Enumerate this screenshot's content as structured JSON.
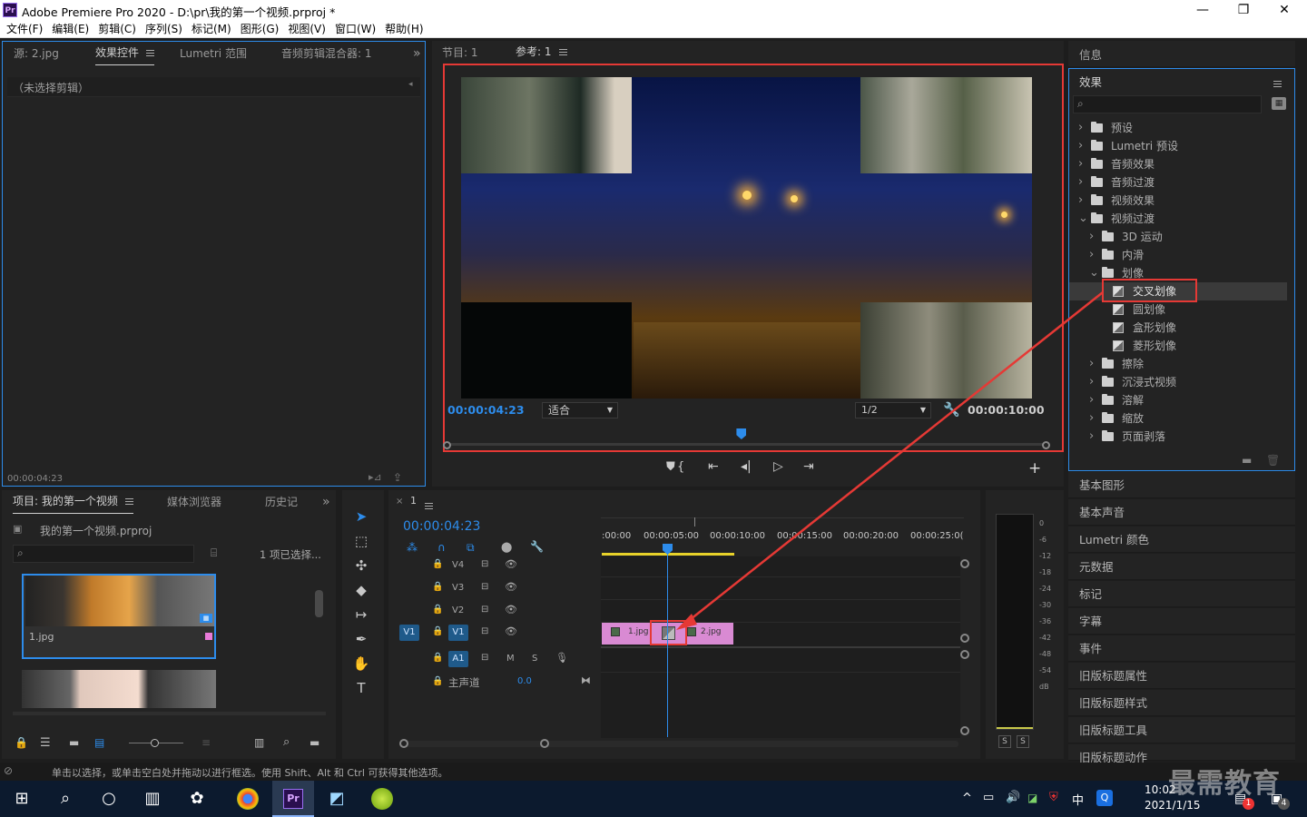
{
  "window": {
    "title": "Adobe Premiere Pro 2020 - D:\\pr\\我的第一个视频.prproj *",
    "app_icon": "Pr",
    "controls": [
      "—",
      "❐",
      "✕"
    ]
  },
  "menu": [
    "文件(F)",
    "编辑(E)",
    "剪辑(C)",
    "序列(S)",
    "标记(M)",
    "图形(G)",
    "视图(V)",
    "窗口(W)",
    "帮助(H)"
  ],
  "source_panel": {
    "tabs": [
      "源: 2.jpg",
      "效果控件",
      "Lumetri 范围",
      "音频剪辑混合器: 1"
    ],
    "active_tab": "效果控件",
    "empty_msg": "（未选择剪辑）",
    "timecode": "00:00:04:23",
    "overflow": "»"
  },
  "program_panel": {
    "tabs": [
      "节目: 1",
      "参考: 1"
    ],
    "timecode": "00:00:04:23",
    "fit": "适合",
    "quality": "1/2",
    "duration": "00:00:10:00",
    "playhead_fraction": 0.49,
    "add_btn": "+"
  },
  "effects_panel": {
    "info_title": "信息",
    "title": "效果",
    "search_placeholder": "",
    "items": [
      {
        "label": "预设",
        "level": 0,
        "expanded": false,
        "kind": "folder-star"
      },
      {
        "label": "Lumetri 预设",
        "level": 0,
        "expanded": false,
        "kind": "folder-star"
      },
      {
        "label": "音频效果",
        "level": 0,
        "expanded": false,
        "kind": "folder"
      },
      {
        "label": "音频过渡",
        "level": 0,
        "expanded": false,
        "kind": "folder"
      },
      {
        "label": "视频效果",
        "level": 0,
        "expanded": false,
        "kind": "folder"
      },
      {
        "label": "视频过渡",
        "level": 0,
        "expanded": true,
        "kind": "folder"
      },
      {
        "label": "3D 运动",
        "level": 1,
        "expanded": false,
        "kind": "folder"
      },
      {
        "label": "内滑",
        "level": 1,
        "expanded": false,
        "kind": "folder"
      },
      {
        "label": "划像",
        "level": 1,
        "expanded": true,
        "kind": "folder"
      },
      {
        "label": "交叉划像",
        "level": 2,
        "kind": "effect",
        "selected": true
      },
      {
        "label": "圆划像",
        "level": 2,
        "kind": "effect"
      },
      {
        "label": "盒形划像",
        "level": 2,
        "kind": "effect"
      },
      {
        "label": "菱形划像",
        "level": 2,
        "kind": "effect"
      },
      {
        "label": "擦除",
        "level": 1,
        "expanded": false,
        "kind": "folder"
      },
      {
        "label": "沉浸式视频",
        "level": 1,
        "expanded": false,
        "kind": "folder"
      },
      {
        "label": "溶解",
        "level": 1,
        "expanded": false,
        "kind": "folder"
      },
      {
        "label": "缩放",
        "level": 1,
        "expanded": false,
        "kind": "folder"
      },
      {
        "label": "页面剥落",
        "level": 1,
        "expanded": false,
        "kind": "folder"
      }
    ]
  },
  "side_panels": [
    "基本图形",
    "基本声音",
    "Lumetri 颜色",
    "元数据",
    "标记",
    "字幕",
    "事件",
    "旧版标题属性",
    "旧版标题样式",
    "旧版标题工具",
    "旧版标题动作"
  ],
  "project_panel": {
    "tabs": [
      "项目: 我的第一个视频",
      "媒体浏览器",
      "历史记"
    ],
    "file": "我的第一个视频.prproj",
    "selection": "1 项已选择...",
    "clips": [
      "1.jpg"
    ]
  },
  "timeline": {
    "tab": "1",
    "timecode": "00:00:04:23",
    "ruler": [
      ":00:00",
      "00:00:05:00",
      "00:00:10:00",
      "00:00:15:00",
      "00:00:20:00",
      "00:00:25:0("
    ],
    "tracks": [
      {
        "src": "",
        "name": "V4"
      },
      {
        "src": "",
        "name": "V3"
      },
      {
        "src": "",
        "name": "V2"
      },
      {
        "src": "V1",
        "name": "V1"
      },
      {
        "src": "",
        "name": "A1",
        "m": "M",
        "s": "S"
      }
    ],
    "master": "主声道",
    "master_value": "0.0",
    "clip1": "1.jpg",
    "clip2": "2.jpg"
  },
  "meter": {
    "scale": [
      "0",
      "-6",
      "-12",
      "-18",
      "-24",
      "-30",
      "-36",
      "-42",
      "-48",
      "-54",
      "dB"
    ],
    "solo": [
      "S",
      "S"
    ]
  },
  "status": "单击以选择，或单击空白处并拖动以进行框选。使用 Shift、Alt 和 Ctrl 可获得其他选项。",
  "taskbar": {
    "time": "10:02",
    "date": "2021/1/15",
    "ime": "中",
    "notif_count": "1",
    "badge4": "4",
    "watermark": "最需教育"
  }
}
